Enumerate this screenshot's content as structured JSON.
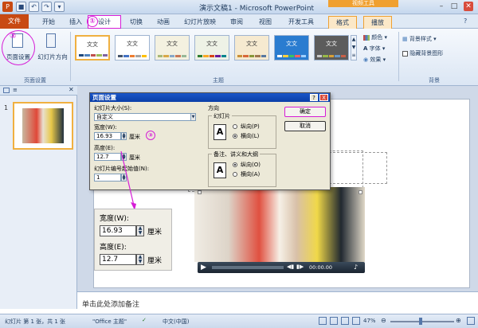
{
  "app_title": "演示文稿1 - Microsoft PowerPoint",
  "video_tools": "视频工具",
  "tabs": [
    "开始",
    "插入",
    "设计",
    "切换",
    "动画",
    "幻灯片放映",
    "审阅",
    "视图",
    "开发工具",
    "格式",
    "播放"
  ],
  "file_tab": "文件",
  "ribbon": {
    "page_setup": "页面设置",
    "orientation": "幻灯片方向",
    "group_page_setup": "页面设置",
    "group_themes": "主题",
    "group_background": "背景",
    "theme_label": "文文",
    "colors": "颜色",
    "fonts": "字体",
    "effects": "效果",
    "bg_styles": "背景样式",
    "hide_bg": "隐藏背景图形"
  },
  "slide_thumb_number": "1",
  "notes_placeholder": "单击此处添加备注",
  "status": {
    "slide_info": "幻灯片 第 1 张，共 1 张",
    "theme": "\"Office 主题\"",
    "language": "中文(中国)",
    "zoom": "47%"
  },
  "dialog": {
    "title": "页面设置",
    "size_label": "幻灯片大小(S):",
    "size_value": "自定义",
    "width_label": "宽度(W):",
    "width_value": "16.93",
    "unit": "厘米",
    "height_label": "高度(E):",
    "height_value": "12.7",
    "start_label": "幻灯片编号起始值(N):",
    "start_value": "1",
    "direction": "方向",
    "slides": "幻灯片",
    "portrait_p": "纵向(P)",
    "landscape_l": "横向(L)",
    "notes_group": "备注、讲义和大纲",
    "portrait_o": "纵向(O)",
    "landscape_a": "横向(A)",
    "ok": "确定",
    "cancel": "取消",
    "help": "?",
    "close": "X"
  },
  "callout": {
    "width_label": "宽度(W):",
    "width_value": "16.93",
    "height_label": "高度(E):",
    "height_value": "12.7",
    "unit": "厘米"
  },
  "video_time": "00:00.00",
  "annotations": [
    "①",
    "②",
    "③"
  ]
}
